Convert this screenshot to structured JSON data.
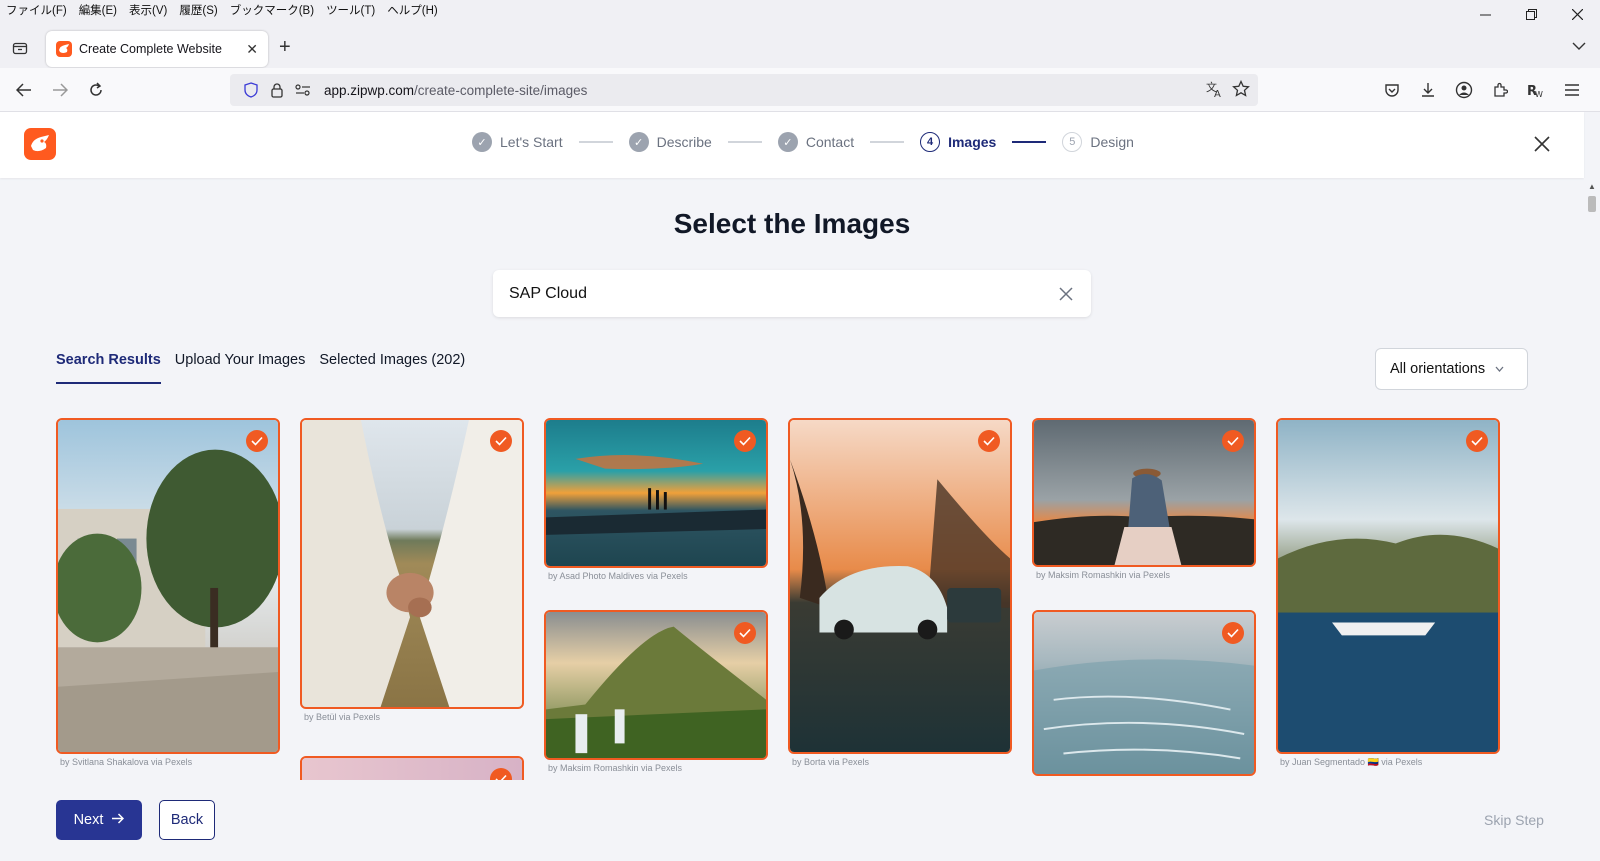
{
  "browser": {
    "menu": [
      "ファイル(F)",
      "編集(E)",
      "表示(V)",
      "履歴(S)",
      "ブックマーク(B)",
      "ツール(T)",
      "ヘルプ(H)"
    ],
    "tab_title": "Create Complete Website",
    "url_domain": "app.zipwp.com",
    "url_path": "/create-complete-site/images"
  },
  "wizard": {
    "steps": [
      {
        "label": "Let's Start",
        "state": "done",
        "num": ""
      },
      {
        "label": "Describe",
        "state": "done",
        "num": ""
      },
      {
        "label": "Contact",
        "state": "done",
        "num": ""
      },
      {
        "label": "Images",
        "state": "active",
        "num": "4"
      },
      {
        "label": "Design",
        "state": "todo",
        "num": "5"
      }
    ]
  },
  "main": {
    "title": "Select the Images",
    "search_value": "SAP Cloud",
    "tabs": [
      {
        "label": "Search Results",
        "active": true
      },
      {
        "label": "Upload Your Images",
        "active": false
      },
      {
        "label": "Selected Images (202)",
        "active": false
      }
    ],
    "orientation": "All orientations"
  },
  "images": [
    {
      "credit": "by Svitlana Shakalova via Pexels",
      "palette": "street",
      "selected": true
    },
    {
      "credit": "by Betül via Pexels",
      "palette": "hands",
      "selected": true
    },
    {
      "credit": "by Asad Photo Maldives via Pexels",
      "palette": "pier",
      "selected": true
    },
    {
      "credit": "by Maksim Romashkin via Pexels",
      "palette": "mountain",
      "selected": true
    },
    {
      "credit": "by Borta via Pexels",
      "palette": "car",
      "selected": true
    },
    {
      "credit": "by Maksim Romashkin via Pexels",
      "palette": "woman",
      "selected": true
    },
    {
      "credit": "",
      "palette": "ice",
      "selected": true
    },
    {
      "credit": "by Juan Segmentado 🇨🇴 via Pexels",
      "palette": "sea",
      "selected": true
    },
    {
      "credit": "",
      "palette": "pink",
      "selected": true
    }
  ],
  "footer": {
    "next_label": "Next",
    "back_label": "Back",
    "skip_label": "Skip Step"
  },
  "colors": {
    "accent": "#f05a22",
    "primary": "#283593"
  }
}
